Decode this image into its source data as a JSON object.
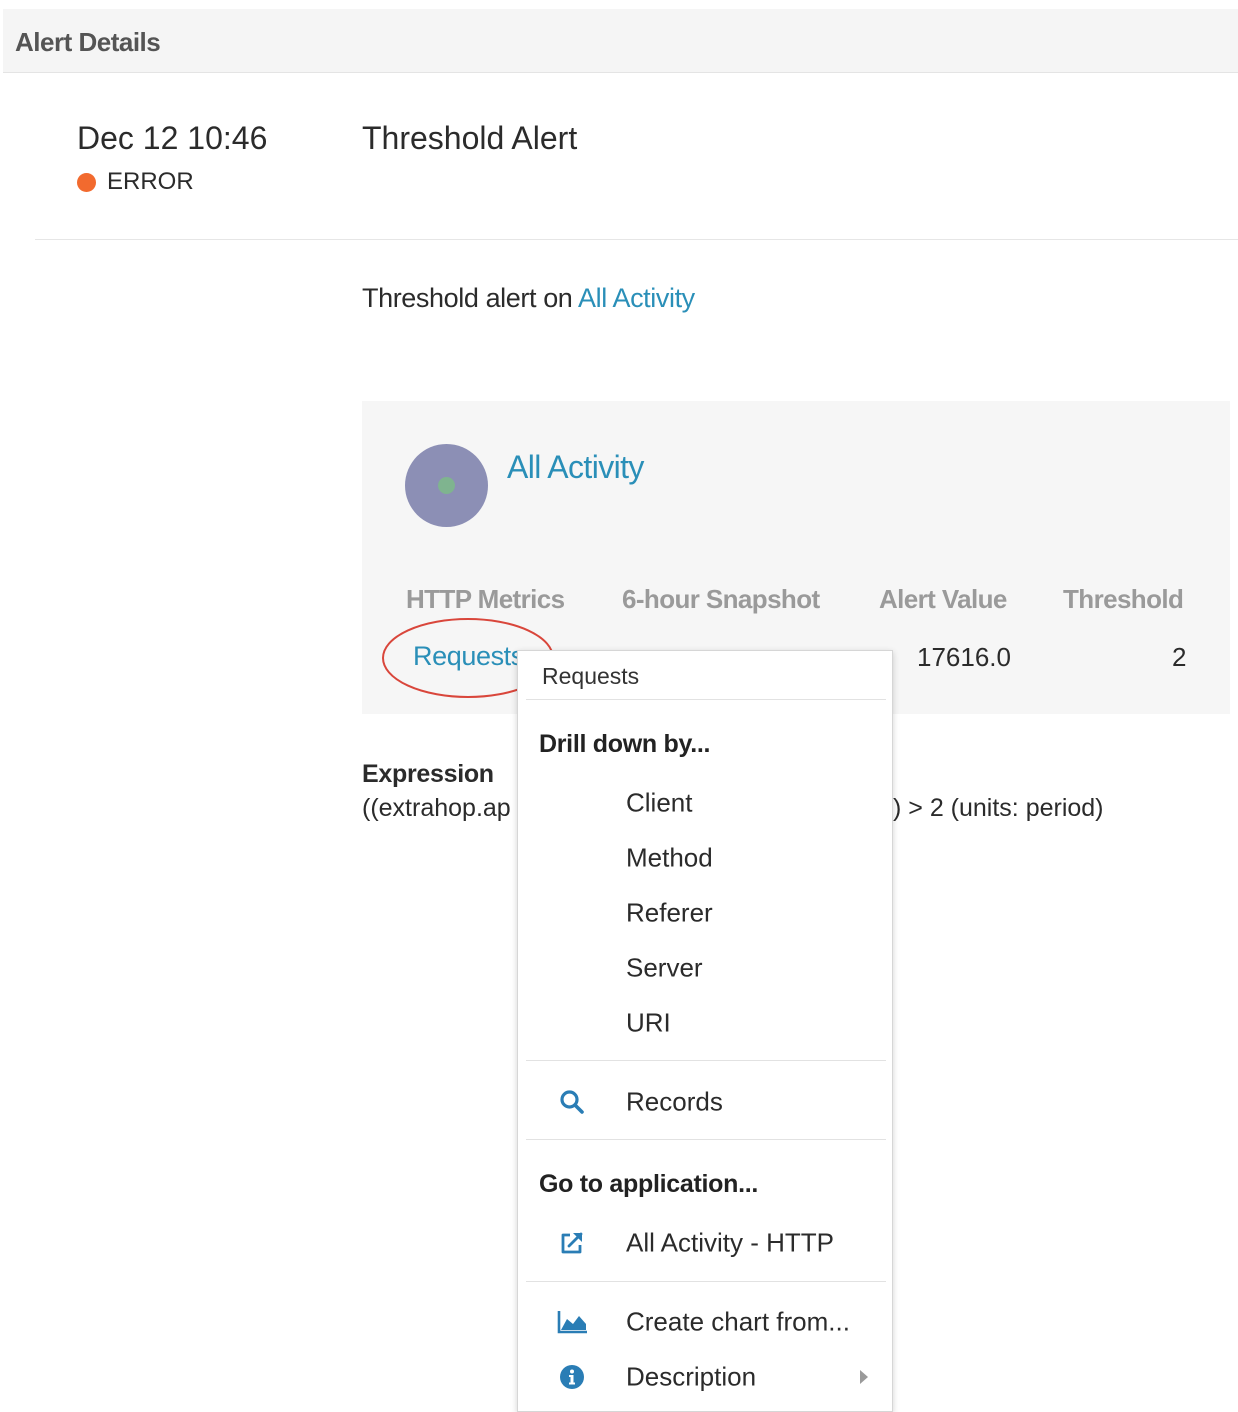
{
  "header": {
    "title": "Alert Details"
  },
  "alert": {
    "date": "Dec 12 10:46",
    "status": "ERROR",
    "status_color": "#f26a2e",
    "title": "Threshold Alert"
  },
  "summary": {
    "prefix": "Threshold alert on ",
    "link": "All Activity"
  },
  "panel": {
    "device_name": "All Activity",
    "columns": [
      "HTTP Metrics",
      "6-hour Snapshot",
      "Alert Value",
      "Threshold"
    ],
    "row": {
      "metric": "Requests",
      "alert_value": "17616.0",
      "threshold": "2"
    }
  },
  "expression": {
    "label": "Expression",
    "text_left": "((extrahop.ap",
    "text_right": ") > 2 (units: period)"
  },
  "context_menu": {
    "title": "Requests",
    "drill_heading": "Drill down by...",
    "drill_items": [
      "Client",
      "Method",
      "Referer",
      "Server",
      "URI"
    ],
    "records_label": "Records",
    "goto_heading": "Go to application...",
    "app_link_label": "All Activity - HTTP",
    "create_chart_label": "Create chart from...",
    "description_label": "Description"
  },
  "colors": {
    "link": "#2a8fb8",
    "icon": "#2a7db5",
    "annotation": "#d9463b",
    "device_circle": "#8c8fb5"
  }
}
